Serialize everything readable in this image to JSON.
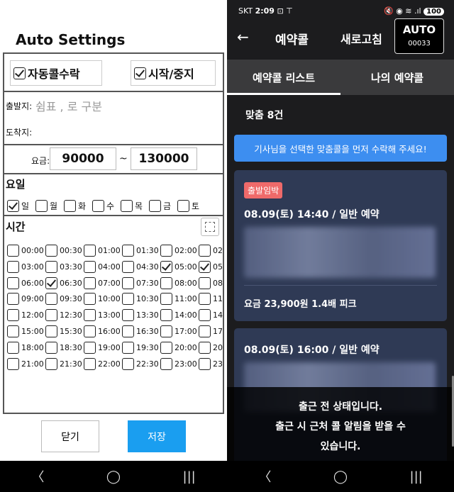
{
  "left": {
    "title": "Auto Settings",
    "auto_accept": {
      "label": "자동콜수락",
      "checked": true
    },
    "start_stop": {
      "label": "시작/중지",
      "checked": true
    },
    "depart_label": "출발지:",
    "depart_placeholder": "쉼표 , 로 구분",
    "arrive_label": "도착지:",
    "fee_label": "요금:",
    "fee_min": "90000",
    "fee_sep": "~",
    "fee_max": "130000",
    "days_title": "요일",
    "days": [
      {
        "label": "일",
        "checked": true
      },
      {
        "label": "월",
        "checked": false
      },
      {
        "label": "화",
        "checked": false
      },
      {
        "label": "수",
        "checked": false
      },
      {
        "label": "목",
        "checked": false
      },
      {
        "label": "금",
        "checked": false
      },
      {
        "label": "토",
        "checked": false
      }
    ],
    "time_title": "시간",
    "times": [
      [
        {
          "t": "00:00",
          "c": false
        },
        {
          "t": "00:30",
          "c": false
        },
        {
          "t": "01:00",
          "c": false
        },
        {
          "t": "01:30",
          "c": false
        },
        {
          "t": "02:00",
          "c": false
        },
        {
          "t": "02",
          "c": false
        }
      ],
      [
        {
          "t": "03:00",
          "c": false
        },
        {
          "t": "03:30",
          "c": false
        },
        {
          "t": "04:00",
          "c": false
        },
        {
          "t": "04:30",
          "c": false
        },
        {
          "t": "05:00",
          "c": true
        },
        {
          "t": "05",
          "c": true
        }
      ],
      [
        {
          "t": "06:00",
          "c": false
        },
        {
          "t": "06:30",
          "c": true
        },
        {
          "t": "07:00",
          "c": false
        },
        {
          "t": "07:30",
          "c": false
        },
        {
          "t": "08:00",
          "c": false
        },
        {
          "t": "08",
          "c": false
        }
      ],
      [
        {
          "t": "09:00",
          "c": false
        },
        {
          "t": "09:30",
          "c": false
        },
        {
          "t": "10:00",
          "c": false
        },
        {
          "t": "10:30",
          "c": false
        },
        {
          "t": "11:00",
          "c": false
        },
        {
          "t": "11",
          "c": false
        }
      ],
      [
        {
          "t": "12:00",
          "c": false
        },
        {
          "t": "12:30",
          "c": false
        },
        {
          "t": "13:00",
          "c": false
        },
        {
          "t": "13:30",
          "c": false
        },
        {
          "t": "14:00",
          "c": false
        },
        {
          "t": "14",
          "c": false
        }
      ],
      [
        {
          "t": "15:00",
          "c": false
        },
        {
          "t": "15:30",
          "c": false
        },
        {
          "t": "16:00",
          "c": false
        },
        {
          "t": "16:30",
          "c": false
        },
        {
          "t": "17:00",
          "c": false
        },
        {
          "t": "17",
          "c": false
        }
      ],
      [
        {
          "t": "18:00",
          "c": false
        },
        {
          "t": "18:30",
          "c": false
        },
        {
          "t": "19:00",
          "c": false
        },
        {
          "t": "19:30",
          "c": false
        },
        {
          "t": "20:00",
          "c": false
        },
        {
          "t": "20",
          "c": false
        }
      ],
      [
        {
          "t": "21:00",
          "c": false
        },
        {
          "t": "21:30",
          "c": false
        },
        {
          "t": "22:00",
          "c": false
        },
        {
          "t": "22:30",
          "c": false
        },
        {
          "t": "23:00",
          "c": false
        },
        {
          "t": "23",
          "c": false
        }
      ]
    ],
    "close_label": "닫기",
    "save_label": "저장"
  },
  "right": {
    "status": {
      "carrier": "SKT",
      "time": "2:09",
      "battery": "100"
    },
    "title": "예약콜",
    "refresh_label": "새로고침",
    "auto_label": "AUTO",
    "auto_code": "00033",
    "tabs": [
      "예약콜 리스트",
      "나의 예약콜"
    ],
    "count": "맞춤 8건",
    "notice": "기사님을 선택한 맞춤콜을 먼저 수락해 주세요!",
    "card1": {
      "badge": "출발임박",
      "datetime": "08.09(토) 14:40 / 일반 예약",
      "fee": "요금 23,900원 1.4배 피크"
    },
    "card2": {
      "datetime": "08.09(토) 16:00 / 일반 예약"
    },
    "toast": [
      "출근 전 상태입니다.",
      "출근 시 근처 콜 알림을 받을 수",
      "있습니다."
    ]
  }
}
